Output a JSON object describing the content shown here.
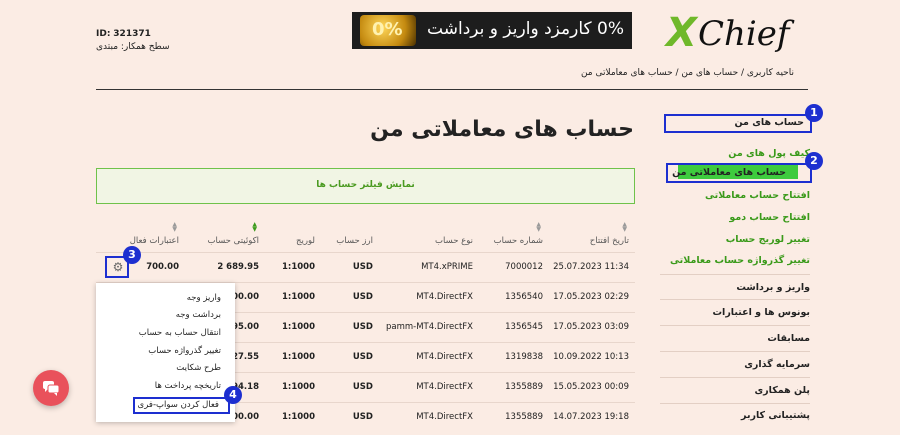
{
  "header": {
    "account_id_label": "ID:",
    "account_id_value": "321371",
    "partner_level": "سطح همکار: مبتدی",
    "banner_text": "0% کارمزد واریز و برداشت",
    "banner_graphic": "0%",
    "logo_x": "X",
    "logo_rest": "Chief"
  },
  "breadcrumb": "ناحیه کاربری  /  حساب های من  /  حساب های معاملاتی من",
  "page_title": "حساب های معاملاتی من",
  "filter_label": "نمایش فیلتر حساب ها",
  "sidebar": {
    "my_accounts": "حساب های من",
    "wallet": "کیف پول های من",
    "trading_accounts": "حساب های معاملاتی من",
    "open_trading": "افتتاح حساب معاملاتی",
    "open_demo": "افتتاح حساب دمو",
    "change_leverage": "تغییر لوریج حساب",
    "change_password": "تغییر گذرواژه حساب معاملاتی",
    "deposit_withdraw": "واریز و برداشت",
    "bonuses": "بونوس ها و اعتبارات",
    "contests": "مسابقات",
    "investment": "سرمایه گذاری",
    "partnership": "پلن همکاری",
    "support": "پشتیبانی کاربر"
  },
  "table": {
    "headers": [
      "تاریخ افتتاح",
      "شماره حساب",
      "نوع حساب",
      "ارز حساب",
      "لوریج",
      "اکوئیتی حساب",
      "اعتبارات فعال"
    ],
    "rows": [
      [
        "25.07.2023 11:34",
        "7000012",
        "MT4.xPRIME",
        "USD",
        "1:1000",
        "2 689.95",
        "700.00"
      ],
      [
        "17.05.2023 02:29",
        "1356540",
        "MT4.DirectFX",
        "USD",
        "1:1000",
        "600.00",
        ""
      ],
      [
        "17.05.2023 03:09",
        "1356545",
        "pamm-MT4.DirectFX",
        "USD",
        "1:1000",
        "395.00",
        ""
      ],
      [
        "10.09.2022 10:13",
        "1319838",
        "MT4.DirectFX",
        "USD",
        "1:1000",
        "227.55",
        ""
      ],
      [
        "15.05.2023 00:09",
        "1355889",
        "MT4.DirectFX",
        "USD",
        "1:1000",
        "194.18",
        ""
      ],
      [
        "14.07.2023 19:18",
        "1355889",
        "MT4.DirectFX",
        "USD",
        "1:1000",
        "100.00",
        ""
      ]
    ]
  },
  "context_menu": [
    "واریز وجه",
    "برداشت وجه",
    "انتقال حساب به حساب",
    "تغییر گذرواژه حساب",
    "طرح شکایت",
    "تاریخچه پرداخت ها",
    "فعال کردن سواپ-فری"
  ],
  "annotations": [
    "1",
    "2",
    "3",
    "4"
  ],
  "colors": {
    "background": "#fbece4",
    "accent_green": "#3a9a1a",
    "highlight_blue": "#1d2fd0",
    "chat": "#e9515b"
  }
}
